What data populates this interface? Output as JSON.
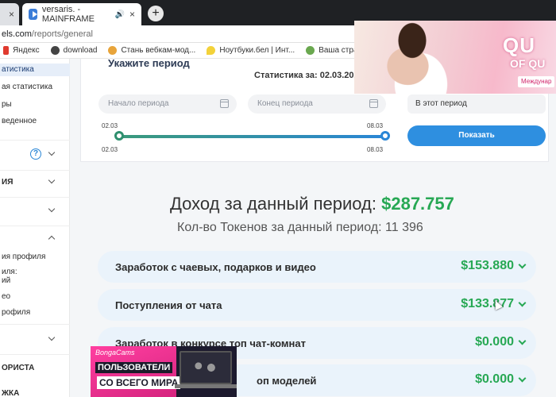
{
  "browser": {
    "tabs": [
      {
        "label": "",
        "close": "×"
      },
      {
        "label": "versaris. - MAINFRAME",
        "close": "×"
      }
    ],
    "new_tab": "+",
    "url_host": "els.com",
    "url_path": "/reports/general"
  },
  "bookmarks": [
    {
      "label": "Яндекс",
      "color": "#e03a2f"
    },
    {
      "label": "download",
      "color": "#444444"
    },
    {
      "label": "Стань вебкам-мод...",
      "color": "#e8a43a"
    },
    {
      "label": "Ноутбуки.бел | Инт...",
      "color": "#f3d23a"
    },
    {
      "label": "Ваша страница тра...",
      "color": "#6aa84f"
    }
  ],
  "sidebar": {
    "items": [
      "атистика",
      "ая статистика",
      "ры",
      "веденное",
      "ИЯ",
      "ия профиля",
      "иля:",
      "ий",
      "ео",
      "рофиля",
      "ОРИСТА",
      "ЖКА"
    ]
  },
  "period": {
    "title": "Укажите период",
    "stat_for": "Статистика за: 02.03.2020 - 0",
    "start_placeholder": "Начало периода",
    "end_placeholder": "Конец периода",
    "select_value": "В этот период",
    "show_button": "Показать",
    "range_start": "02.03",
    "range_end": "08.03"
  },
  "summary": {
    "income_label": "Доход за данный период:",
    "income_value": "$287.757",
    "tokens": "Кол-во Токенов за данный период: 11 396"
  },
  "rows": [
    {
      "label": "Заработок с чаевых, подарков и видео",
      "value": "$153.880"
    },
    {
      "label": "Поступления от чата",
      "value": "$133.877"
    },
    {
      "label": "Заработок в конкурсе топ чат-комнат",
      "value": "$0.000"
    },
    {
      "label": "оп моделей",
      "value": "$0.000"
    }
  ],
  "ads": {
    "top_word": "QU",
    "top_word2": "OF QU",
    "top_tag": "Междунар",
    "bottom_logo": "BongaCams",
    "bottom_line1": "ПОЛЬЗОВАТЕЛИ",
    "bottom_line2": "СО ВСЕГО МИРА"
  }
}
